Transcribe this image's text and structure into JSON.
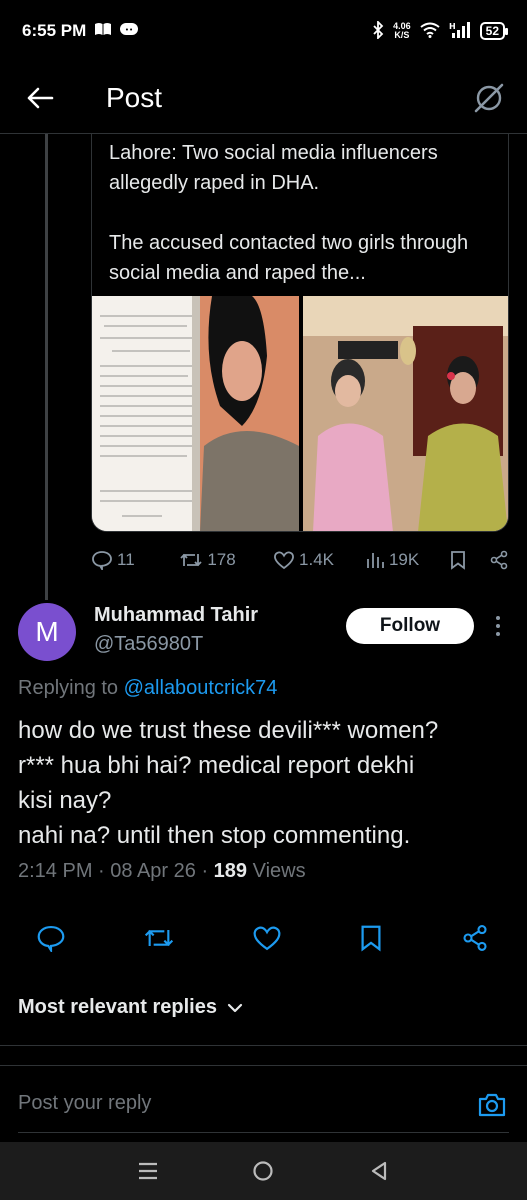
{
  "status_bar": {
    "time": "6:55 PM",
    "net_speed_value": "4.06",
    "net_speed_unit": "K/S",
    "signal_label": "H",
    "battery": "52"
  },
  "header": {
    "title": "Post"
  },
  "quoted_post": {
    "paragraph_1": "Lahore: Two social media influencers allegedly raped in DHA.",
    "paragraph_2": "The accused contacted two girls through social media and raped the..."
  },
  "quoted_actions": {
    "replies": "11",
    "reposts": "178",
    "likes": "1.4K",
    "views": "19K"
  },
  "reply": {
    "avatar_letter": "M",
    "display_name": "Muhammad Tahir",
    "handle": "@Ta56980T",
    "follow_label": "Follow",
    "replying_prefix": "Replying to ",
    "replying_handle": "@allaboutcrick74",
    "body_lines": [
      "how do we trust these devili*** women?",
      "r*** hua bhi hai? medical report dekhi",
      "kisi nay?",
      "nahi na? until then stop commenting."
    ],
    "timestamp": "2:14 PM · 08 Apr 26 · ",
    "views_count": "189",
    "views_label": " Views"
  },
  "replies_section": {
    "sort_label": "Most relevant replies"
  },
  "composer": {
    "placeholder": "Post your reply"
  },
  "colors": {
    "accent": "#1d9bf0",
    "muted": "#71767b",
    "avatar": "#7a4fcf"
  }
}
